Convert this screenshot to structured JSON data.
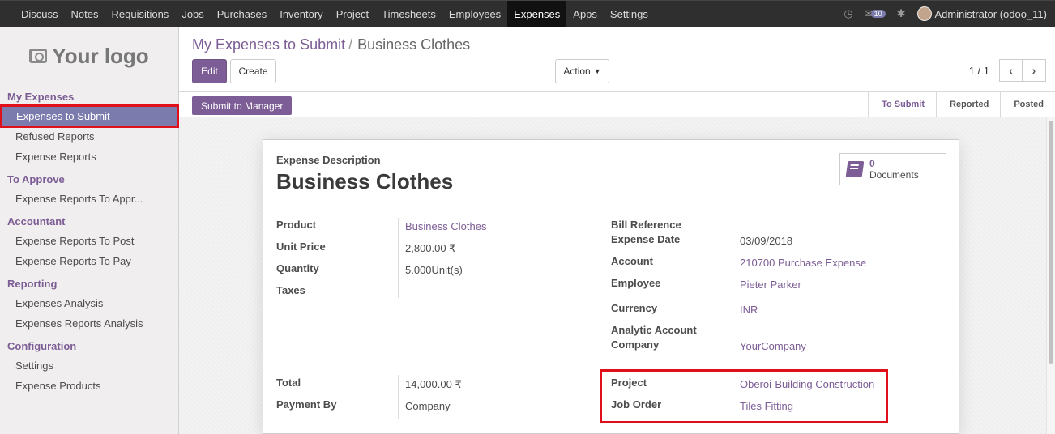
{
  "topbar": {
    "menu": [
      "Discuss",
      "Notes",
      "Requisitions",
      "Jobs",
      "Purchases",
      "Inventory",
      "Project",
      "Timesheets",
      "Employees",
      "Expenses",
      "Apps",
      "Settings"
    ],
    "active": "Expenses",
    "messages_count": "10",
    "user": "Administrator (odoo_11)"
  },
  "sidebar": {
    "logo_text": "Your logo",
    "sections": [
      {
        "title": "My Expenses",
        "items": [
          "Expenses to Submit",
          "Refused Reports",
          "Expense Reports"
        ]
      },
      {
        "title": "To Approve",
        "items": [
          "Expense Reports To Appr..."
        ]
      },
      {
        "title": "Accountant",
        "items": [
          "Expense Reports To Post",
          "Expense Reports To Pay"
        ]
      },
      {
        "title": "Reporting",
        "items": [
          "Expenses Analysis",
          "Expenses Reports Analysis"
        ]
      },
      {
        "title": "Configuration",
        "items": [
          "Settings",
          "Expense Products"
        ]
      }
    ],
    "active_item": "Expenses to Submit"
  },
  "breadcrumb": {
    "parent": "My Expenses to Submit",
    "separator": "/",
    "current": "Business Clothes"
  },
  "buttons": {
    "edit": "Edit",
    "create": "Create",
    "action": "Action",
    "submit": "Submit to Manager"
  },
  "pager": {
    "value": "1 / 1",
    "prev": "‹",
    "next": "›"
  },
  "stages": [
    {
      "label": "To Submit",
      "current": true
    },
    {
      "label": "Reported",
      "current": false
    },
    {
      "label": "Posted",
      "current": false
    }
  ],
  "form": {
    "description_label": "Expense Description",
    "title": "Business Clothes",
    "documents": {
      "count": "0",
      "label": "Documents"
    },
    "left": {
      "product_label": "Product",
      "product": "Business Clothes",
      "unit_price_label": "Unit Price",
      "unit_price": "2,800.00 ₹",
      "quantity_label": "Quantity",
      "quantity": "5.000Unit(s)",
      "taxes_label": "Taxes",
      "total_label": "Total",
      "total": "14,000.00 ₹",
      "payment_label": "Payment By",
      "payment": "Company"
    },
    "right": {
      "bill_ref_label": "Bill Reference",
      "expense_date_label": "Expense Date",
      "expense_date": "03/09/2018",
      "account_label": "Account",
      "account": "210700 Purchase Expense",
      "employee_label": "Employee",
      "employee": "Pieter Parker",
      "currency_label": "Currency",
      "currency": "INR",
      "analytic_label": "Analytic Account",
      "company_label": "Company",
      "company": "YourCompany",
      "project_label": "Project",
      "project": "Oberoi-Building Construction",
      "job_order_label": "Job Order",
      "job_order": "Tiles Fitting"
    }
  },
  "colors": {
    "accent": "#7c5d95",
    "highlight": "#e0101a",
    "navbar": "#2f2f2f"
  }
}
